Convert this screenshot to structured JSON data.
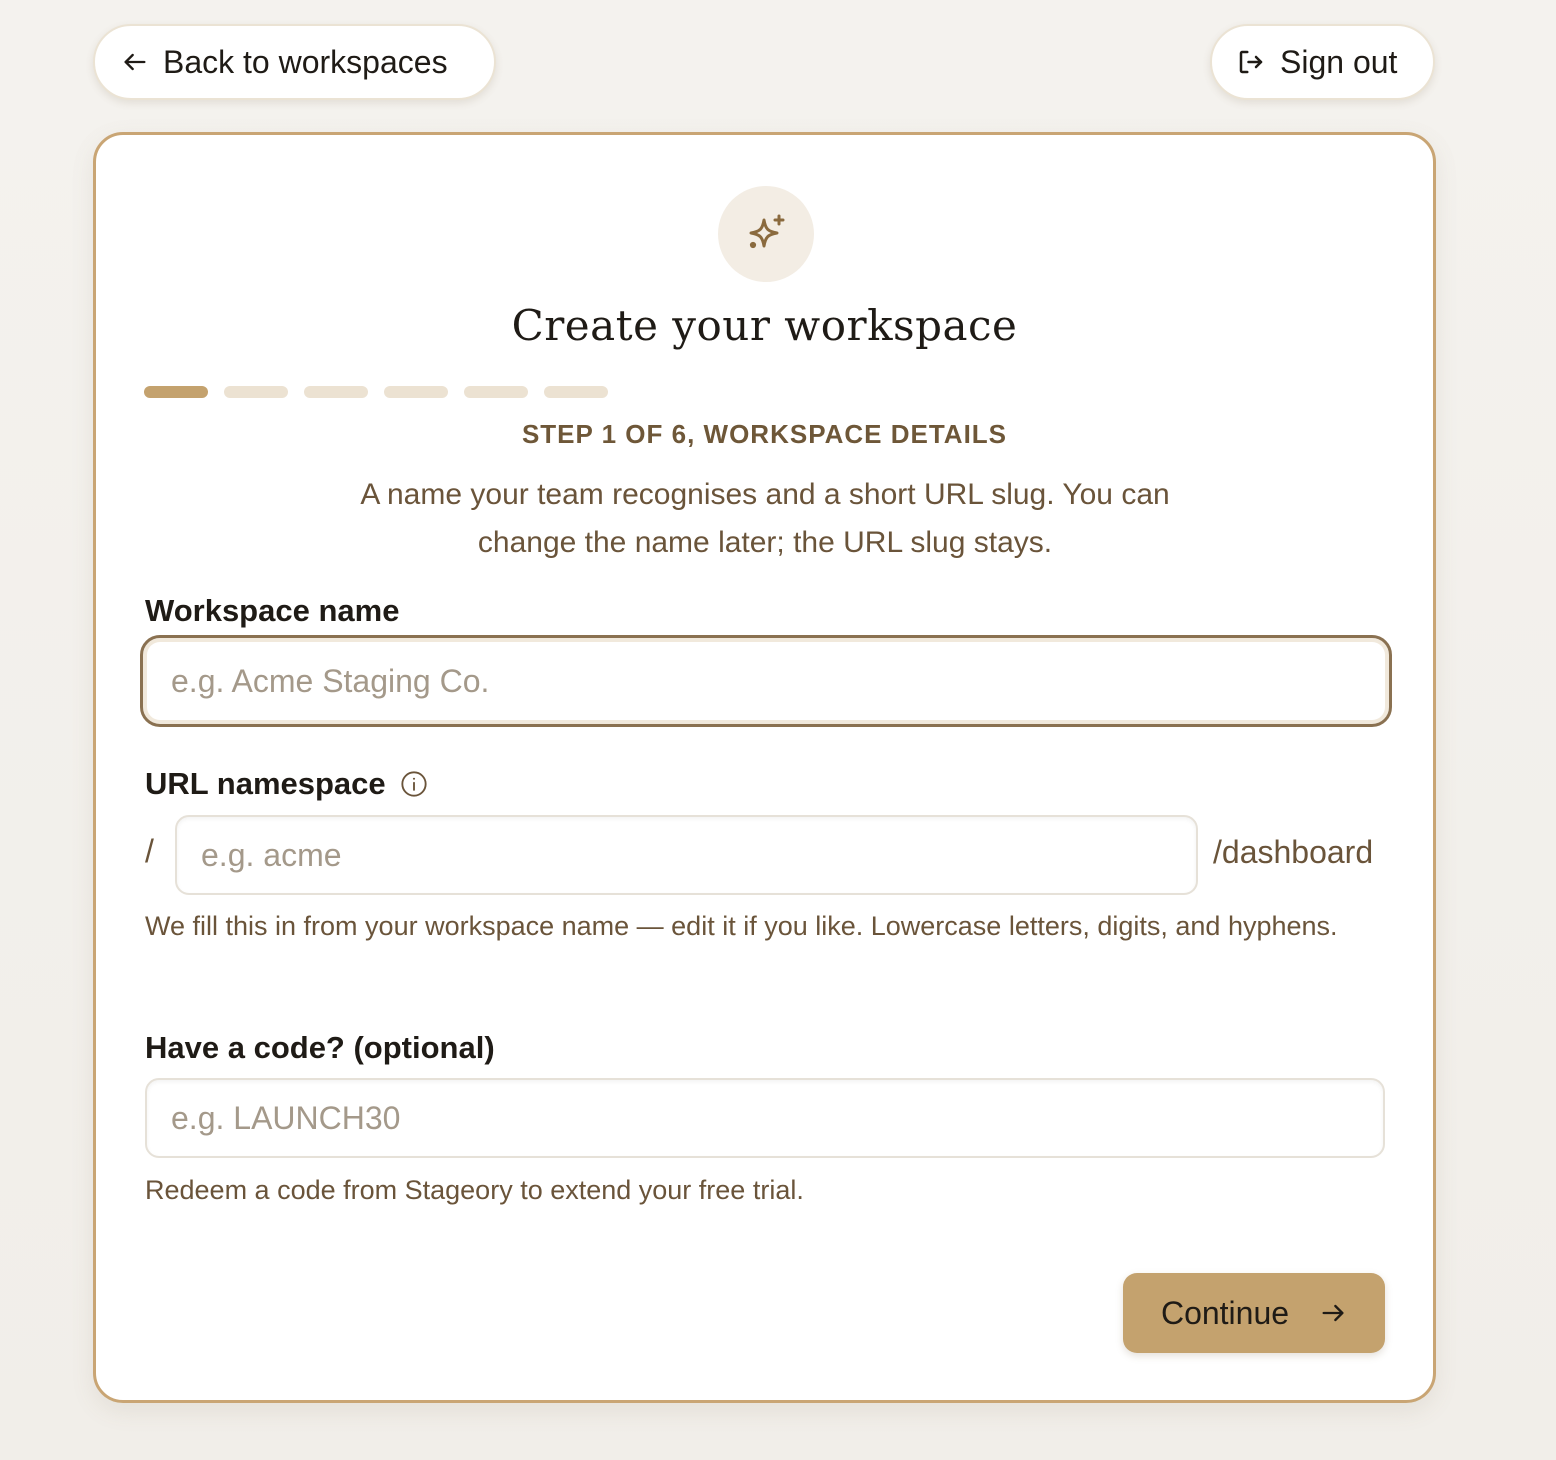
{
  "header": {
    "back_label": "Back to workspaces",
    "signout_label": "Sign out"
  },
  "card": {
    "icon": "sparkles-icon",
    "title": "Create your workspace",
    "progress": {
      "current_step": 1,
      "total_steps": 6
    },
    "step_label": "STEP 1 OF 6, WORKSPACE DETAILS",
    "intro": "A name your team recognises and a short URL slug. You can change the name later; the URL slug stays."
  },
  "form": {
    "workspace_name": {
      "label": "Workspace name",
      "placeholder": "e.g. Acme Staging Co.",
      "value": ""
    },
    "url_namespace": {
      "label": "URL namespace",
      "prefix": "/",
      "placeholder": "e.g. acme",
      "value": "",
      "suffix": "/dashboard",
      "help": "We fill this in from your workspace name — edit it if you like. Lowercase letters, digits, and hyphens."
    },
    "code": {
      "label": "Have a code? (optional)",
      "placeholder": "e.g. LAUNCH30",
      "value": "",
      "help": "Redeem a code from Stageory to extend your free trial."
    },
    "continue_label": "Continue"
  },
  "colors": {
    "accent": "#c4a26e",
    "card_border": "#c9a574",
    "progress_inactive": "#ece2d2",
    "muted_text": "#6a543a"
  }
}
